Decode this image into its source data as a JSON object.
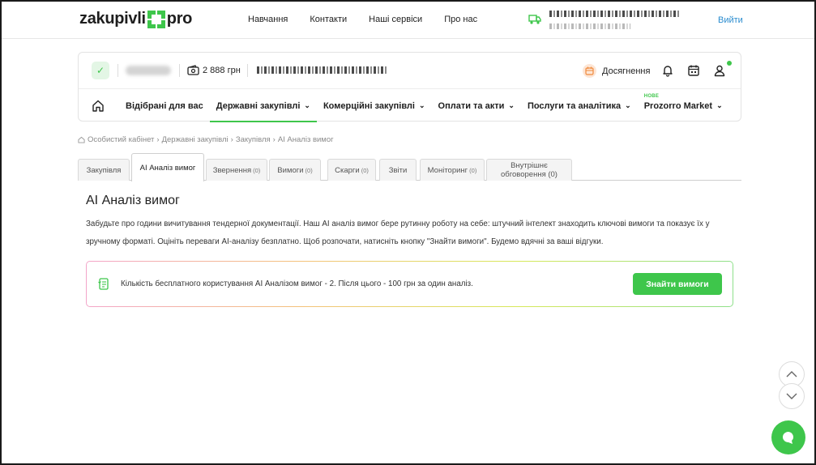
{
  "header": {
    "logo_text": "zakupivli",
    "logo_suffix": "pro",
    "nav": [
      "Навчання",
      "Контакти",
      "Наші сервіси",
      "Про нас"
    ],
    "logout": "Вийти"
  },
  "account": {
    "balance": "2 888 грн",
    "achievements": "Досягнення"
  },
  "main_nav": {
    "items": [
      {
        "label": "Відібрані для вас",
        "dropdown": false
      },
      {
        "label": "Державні закупівлі",
        "dropdown": true
      },
      {
        "label": "Комерційні закупівлі",
        "dropdown": true
      },
      {
        "label": "Оплати та акти",
        "dropdown": true
      },
      {
        "label": "Послуги та аналітика",
        "dropdown": true
      },
      {
        "label": "Prozorro Market",
        "dropdown": true
      }
    ],
    "new_tag": "НОВЕ"
  },
  "breadcrumb": [
    "Особистий кабінет",
    "Державні закупівлі",
    "Закупівля",
    "AI Аналіз вимог"
  ],
  "tabs": [
    {
      "label": "Закупівля",
      "count": ""
    },
    {
      "label": "AI Аналіз вимог",
      "count": ""
    },
    {
      "label": "Звернення",
      "count": "(0)"
    },
    {
      "label": "Вимоги",
      "count": "(0)"
    },
    {
      "label": "Скарги",
      "count": "(0)"
    },
    {
      "label": "Звіти",
      "count": ""
    },
    {
      "label": "Моніторинг",
      "count": "(0)"
    },
    {
      "label": "Внутрішнє обговорення (0)",
      "count": ""
    }
  ],
  "page": {
    "title": "AI Аналіз вимог",
    "description": "Забудьте про години вичитування тендерної документації. Наш AI аналіз вимог бере рутинну роботу на себе: штучний інтелект знаходить ключові вимоги та показує їх у зручному форматі. Оцініть переваги AI-аналізу безплатно. Щоб розпочати, натисніть кнопку \"Знайти вимоги\". Будемо вдячні за ваші відгуки.",
    "banner_text": "Кількість бесплатного користування AI Аналізом вимог - 2. Після цього - 100 грн за один аналіз.",
    "find_button": "Знайти вимоги"
  },
  "colors": {
    "brand_green": "#3ec64b",
    "link_blue": "#2a8ccf"
  }
}
